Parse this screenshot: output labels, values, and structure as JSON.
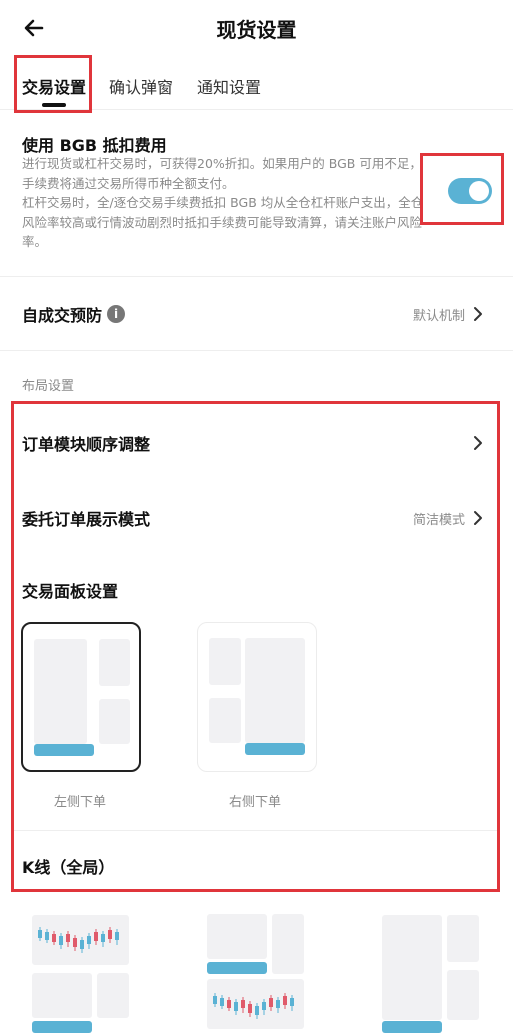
{
  "header": {
    "title": "现货设置"
  },
  "tabs": [
    {
      "label": "交易设置",
      "active": true
    },
    {
      "label": "确认弹窗",
      "active": false
    },
    {
      "label": "通知设置",
      "active": false
    }
  ],
  "bgb": {
    "title": "使用 BGB 抵扣费用",
    "desc1": "进行现货或杠杆交易时，可获得20%折扣。如果用户的 BGB 可用不足，手续费将通过交易所得币种全额支付。",
    "desc2": "杠杆交易时，全/逐仓交易手续费抵扣 BGB 均从全仓杠杆账户支出，全仓风险率较高或行情波动剧烈时抵扣手续费可能导致清算，请关注账户风险率。",
    "enabled": true
  },
  "self_trade": {
    "label": "自成交预防",
    "value": "默认机制"
  },
  "layout_section": {
    "label": "布局设置"
  },
  "order_module": {
    "label": "订单模块顺序调整"
  },
  "order_display": {
    "label": "委托订单展示模式",
    "value": "简洁模式"
  },
  "trade_panel": {
    "title": "交易面板设置",
    "options": [
      {
        "label": "左侧下单",
        "selected": true
      },
      {
        "label": "右侧下单",
        "selected": false
      }
    ]
  },
  "kline": {
    "title": "K线（全局）"
  },
  "colors": {
    "accent": "#5ab2d4",
    "highlight_frame": "#e0353b",
    "candle_up": "#5ab2d4",
    "candle_down": "#e05a6a"
  },
  "icons": {
    "back": "arrow-left-icon",
    "chevron": "chevron-right-icon",
    "info": "info-icon"
  }
}
